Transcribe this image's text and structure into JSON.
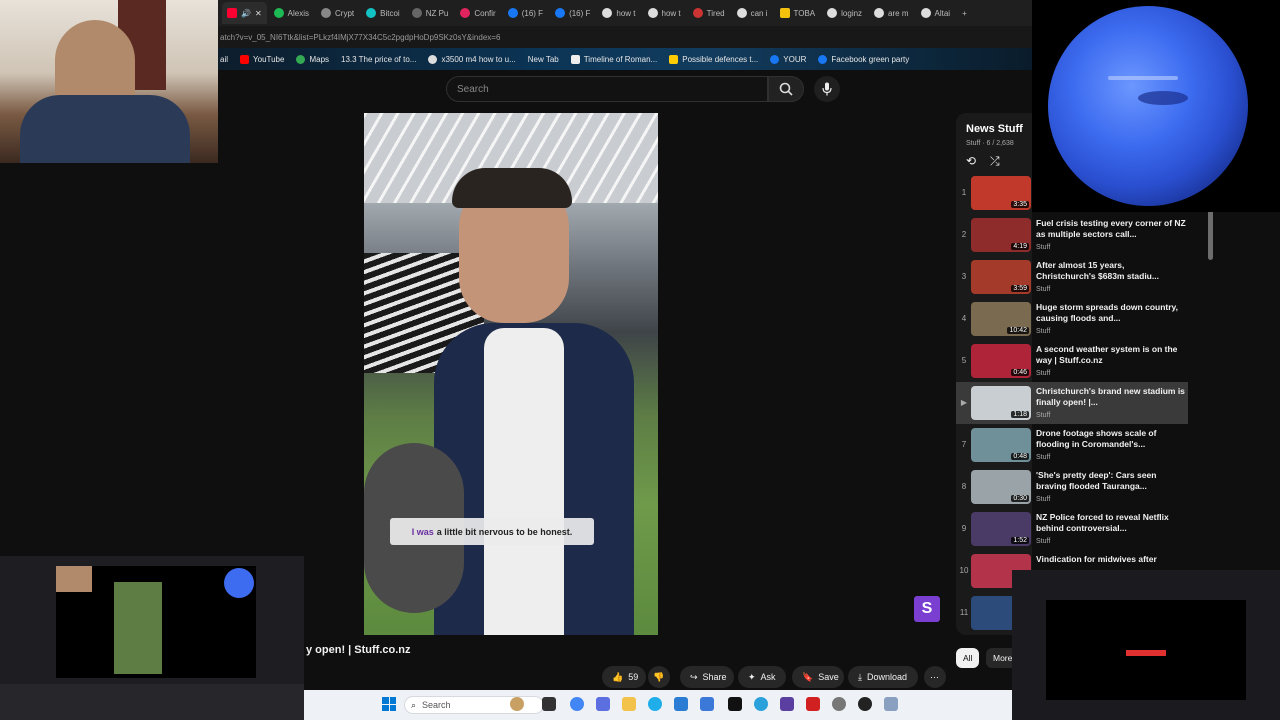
{
  "browser": {
    "tabs": [
      {
        "label": "",
        "color": "#ff0033",
        "active": true
      },
      {
        "label": "Alexis",
        "color": "#1db954"
      },
      {
        "label": "Crypt",
        "color": "#888888"
      },
      {
        "label": "Bitcoi",
        "color": "#13c2c2"
      },
      {
        "label": "NZ Pu",
        "color": "#666666"
      },
      {
        "label": "Confir",
        "color": "#e0245e"
      },
      {
        "label": "(16) F",
        "color": "#1877f2"
      },
      {
        "label": "(16) F",
        "color": "#1877f2"
      },
      {
        "label": "how t",
        "color": "#dddddd"
      },
      {
        "label": "how t",
        "color": "#dddddd"
      },
      {
        "label": "Tired",
        "color": "#cc3333"
      },
      {
        "label": "can i",
        "color": "#dddddd"
      },
      {
        "label": "TOBA",
        "color": "#f4c20d"
      },
      {
        "label": "loginz",
        "color": "#dddddd"
      },
      {
        "label": "are m",
        "color": "#dddddd"
      },
      {
        "label": "Altai",
        "color": "#dddddd"
      }
    ],
    "address": "atch?v=v_05_NI6Ttk&list=PLkzf4IMjX77X34C5c2pgdpHoDp9SKz0sY&index=6",
    "bookmarks": [
      {
        "label": "ail",
        "color": "#444444"
      },
      {
        "label": "YouTube",
        "color": "#ff0000"
      },
      {
        "label": "Maps",
        "color": "#34a853"
      },
      {
        "label": "13.3 The price of to...",
        "color": "#777777"
      },
      {
        "label": "x3500 m4 how to u...",
        "color": "#dddddd"
      },
      {
        "label": "New Tab",
        "color": "#555555"
      },
      {
        "label": "Timeline of Roman...",
        "color": "#eeeeee"
      },
      {
        "label": "Possible defences t...",
        "color": "#ffcc00"
      },
      {
        "label": "YOUR",
        "color": "#1877f2"
      },
      {
        "label": "Facebook green party",
        "color": "#1877f2"
      }
    ]
  },
  "search": {
    "placeholder": "Search"
  },
  "video": {
    "caption_highlight": "I was",
    "caption_rest": "a little bit nervous to be honest."
  },
  "title_fragment": "y open! | Stuff.co.nz",
  "actions": {
    "likes": "59",
    "share": "Share",
    "ask": "Ask",
    "save": "Save",
    "download": "Download"
  },
  "chips": {
    "all": "All",
    "more": "More"
  },
  "playlist": {
    "title": "News Stuff",
    "meta": "Stuff · 6 / 2,638",
    "items": [
      {
        "index": "1",
        "title": "",
        "channel": "",
        "duration": "3:35",
        "thumb": "#c0392b"
      },
      {
        "index": "2",
        "title": "Fuel crisis testing every corner of NZ as multiple sectors call...",
        "channel": "Stuff",
        "duration": "4:19",
        "thumb": "#8e2b2b"
      },
      {
        "index": "3",
        "title": "After almost 15 years, Christchurch's $683m stadiu...",
        "channel": "Stuff",
        "duration": "3:59",
        "thumb": "#a33a2a"
      },
      {
        "index": "4",
        "title": "Huge storm spreads down country, causing floods and...",
        "channel": "Stuff",
        "duration": "10:42",
        "thumb": "#7a6a50"
      },
      {
        "index": "5",
        "title": "A second weather system is on the way | Stuff.co.nz",
        "channel": "Stuff",
        "duration": "0:46",
        "thumb": "#b0243a"
      },
      {
        "index": "▶",
        "title": "Christchurch's brand new stadium is finally open! |...",
        "channel": "Stuff",
        "duration": "1:18",
        "thumb": "#c9ced3"
      },
      {
        "index": "7",
        "title": "Drone footage shows scale of flooding in Coromandel's...",
        "channel": "Stuff",
        "duration": "0:48",
        "thumb": "#6f8f99"
      },
      {
        "index": "8",
        "title": "'She's pretty deep': Cars seen braving flooded Tauranga...",
        "channel": "Stuff",
        "duration": "0:30",
        "thumb": "#9aa3a8"
      },
      {
        "index": "9",
        "title": "NZ Police forced to reveal Netflix behind controversial...",
        "channel": "Stuff",
        "duration": "1:52",
        "thumb": "#4a3a66"
      },
      {
        "index": "10",
        "title": "Vindication for midwives after",
        "channel": "",
        "duration": "",
        "thumb": "#b3344a"
      },
      {
        "index": "11",
        "title": "",
        "channel": "",
        "duration": "",
        "thumb": "#2c4a7a"
      }
    ]
  },
  "taskbar": {
    "search_label": "Search"
  },
  "overlay_badge": "S"
}
